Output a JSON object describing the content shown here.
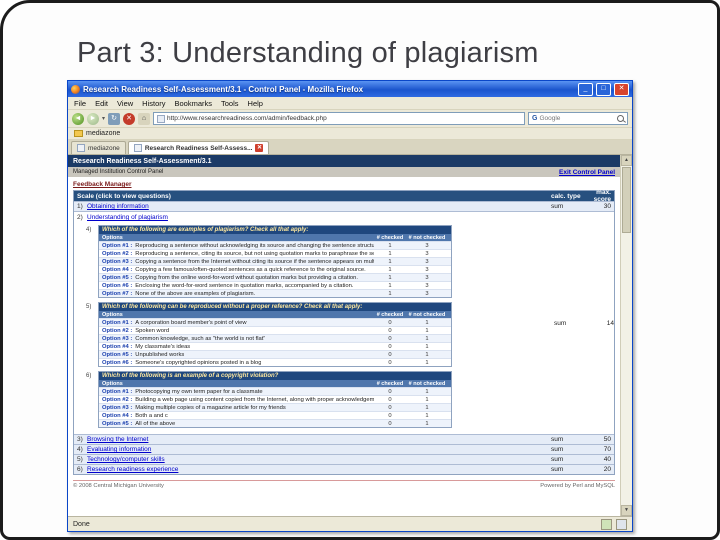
{
  "slide": {
    "title": "Part 3: Understanding of plagiarism"
  },
  "browser": {
    "window_title": "Research Readiness Self-Assessment/3.1 - Control Panel - Mozilla Firefox",
    "menu_items": [
      "File",
      "Edit",
      "View",
      "History",
      "Bookmarks",
      "Tools",
      "Help"
    ],
    "address_url": "http://www.researchreadiness.com/admin/feedback.php",
    "search_placeholder": "Google",
    "bookmarks": [
      "mediazone"
    ],
    "tabs": [
      {
        "label": "mediazone",
        "active": false
      },
      {
        "label": "Research Readiness Self-Assess...",
        "active": true
      }
    ],
    "status_text": "Done"
  },
  "page": {
    "header_title": "Research Readiness Self-Assessment/3.1",
    "subheader": "Managed Institution Control Panel",
    "exit_link": "Exit Control Panel",
    "section_label": "Feedback Manager",
    "scale_table": {
      "title": "Scale (click to view questions)",
      "calc_col": "calc. type",
      "max_col": "max. score",
      "rows": [
        {
          "num": "1)",
          "label": "Obtaining information",
          "calc": "sum",
          "max": "30",
          "expanded": false
        },
        {
          "num": "2)",
          "label": "Understanding of plagiarism",
          "calc": "sum",
          "max": "14",
          "expanded": true
        },
        {
          "num": "3)",
          "label": "Browsing the Internet",
          "calc": "sum",
          "max": "50",
          "expanded": false
        },
        {
          "num": "4)",
          "label": "Evaluating information",
          "calc": "sum",
          "max": "70",
          "expanded": false
        },
        {
          "num": "5)",
          "label": "Technology/computer skills",
          "calc": "sum",
          "max": "40",
          "expanded": false
        },
        {
          "num": "6)",
          "label": "Research readiness experience",
          "calc": "sum",
          "max": "20",
          "expanded": false
        }
      ]
    },
    "questions": [
      {
        "num": "4)",
        "title": "Which of the following are examples of plagiarism? Check all that apply:",
        "options_col": "Options",
        "checked_col": "# checked",
        "not_checked_col": "# not checked",
        "options": [
          {
            "label": "Option #1 :",
            "text": "Reproducing a sentence without acknowledging its source and changing the sentence structure.",
            "checked": "1",
            "not_checked": "3"
          },
          {
            "label": "Option #2 :",
            "text": "Reproducing a sentence, citing its source, but not using quotation marks to paraphrase the sentence.",
            "checked": "1",
            "not_checked": "3"
          },
          {
            "label": "Option #3 :",
            "text": "Copying a sentence from the Internet without citing its source if the sentence appears on multiple web sites.",
            "checked": "1",
            "not_checked": "3"
          },
          {
            "label": "Option #4 :",
            "text": "Copying a few famous/often-quoted sentences as a quick reference to the original source.",
            "checked": "1",
            "not_checked": "3"
          },
          {
            "label": "Option #5 :",
            "text": "Copying from the online word-for-word without quotation marks but providing a citation.",
            "checked": "1",
            "not_checked": "3"
          },
          {
            "label": "Option #6 :",
            "text": "Enclosing the word-for-word sentence in quotation marks, accompanied by a citation.",
            "checked": "1",
            "not_checked": "3"
          },
          {
            "label": "Option #7 :",
            "text": "None of the above are examples of plagiarism.",
            "checked": "1",
            "not_checked": "3"
          }
        ]
      },
      {
        "num": "5)",
        "title": "Which of the following can be reproduced without a proper reference? Check all that apply:",
        "options_col": "Options",
        "checked_col": "# checked",
        "not_checked_col": "# not checked",
        "options": [
          {
            "label": "Option #1 :",
            "text": "A corporation board member's point of view",
            "checked": "0",
            "not_checked": "1"
          },
          {
            "label": "Option #2 :",
            "text": "Spoken word",
            "checked": "0",
            "not_checked": "1"
          },
          {
            "label": "Option #3 :",
            "text": "Common knowledge, such as \"the world is not flat\"",
            "checked": "0",
            "not_checked": "1"
          },
          {
            "label": "Option #4 :",
            "text": "My classmate's ideas",
            "checked": "0",
            "not_checked": "1"
          },
          {
            "label": "Option #5 :",
            "text": "Unpublished works",
            "checked": "0",
            "not_checked": "1"
          },
          {
            "label": "Option #6 :",
            "text": "Someone's copyrighted opinions posted in a blog",
            "checked": "0",
            "not_checked": "1"
          }
        ]
      },
      {
        "num": "6)",
        "title": "Which of the following is an example of a copyright violation?",
        "options_col": "Options",
        "checked_col": "# checked",
        "not_checked_col": "# not checked",
        "options": [
          {
            "label": "Option #1 :",
            "text": "Photocopying my own term paper for a classmate",
            "checked": "0",
            "not_checked": "1"
          },
          {
            "label": "Option #2 :",
            "text": "Building a web page using content copied from the Internet, along with proper acknowledgements",
            "checked": "0",
            "not_checked": "1"
          },
          {
            "label": "Option #3 :",
            "text": "Making multiple copies of a magazine article for my friends",
            "checked": "0",
            "not_checked": "1"
          },
          {
            "label": "Option #4 :",
            "text": "Both a and c",
            "checked": "0",
            "not_checked": "1"
          },
          {
            "label": "Option #5 :",
            "text": "All of the above",
            "checked": "0",
            "not_checked": "1"
          }
        ]
      }
    ],
    "footer_left": "© 2008 Central Michigan University",
    "footer_right": "Powered by Perl and MySQL"
  }
}
